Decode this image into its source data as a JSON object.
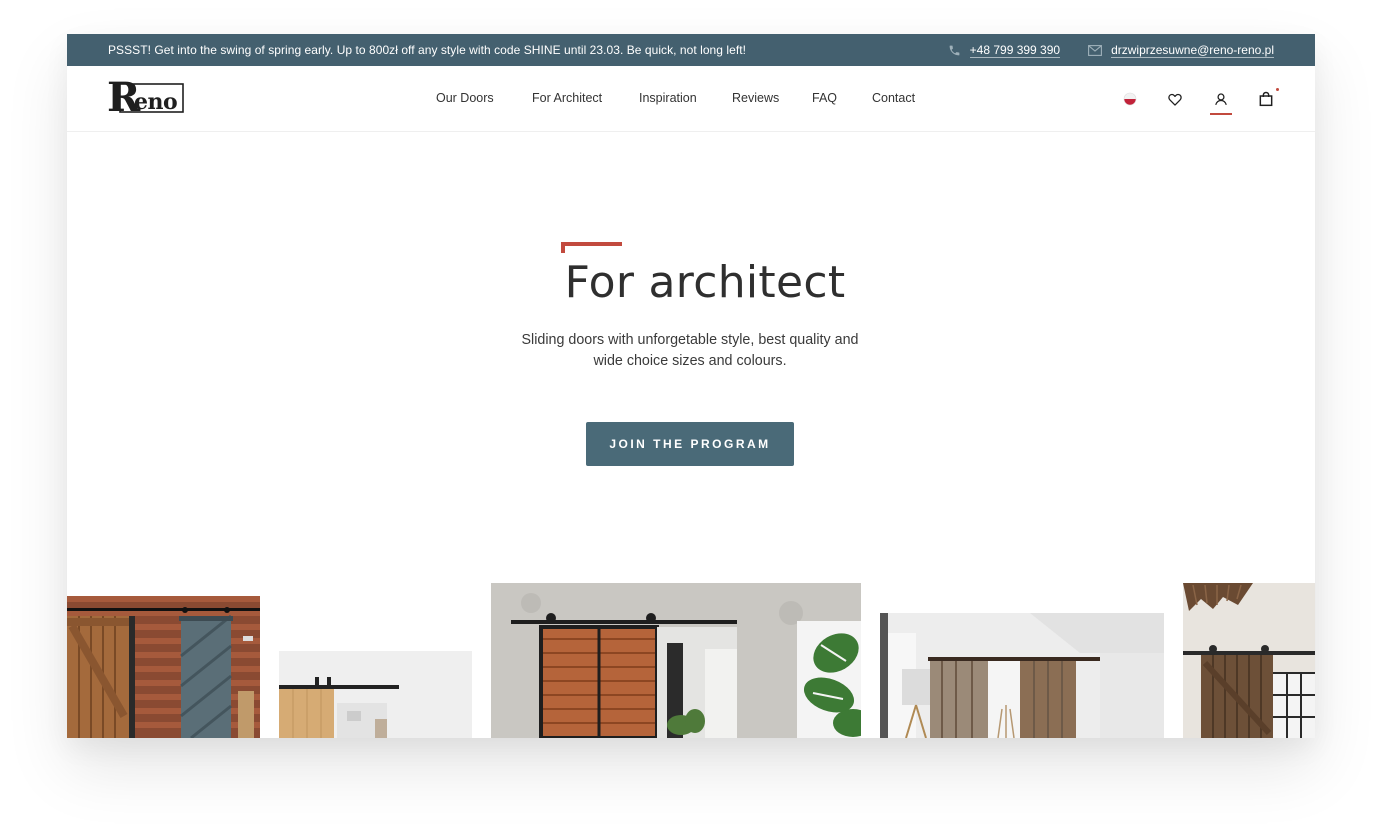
{
  "topbar": {
    "promo": "PSSST! Get into the swing of spring early. Up to 800zł off any style with code SHINE until 23.03. Be quick, not long left!",
    "phone": "+48 799 399 390",
    "email": "drzwiprzesuwne@reno-reno.pl",
    "phone_icon": "phone-icon",
    "email_icon": "mail-icon"
  },
  "header": {
    "logo_text": "Reno",
    "nav": [
      "Our Doors",
      "For Architect",
      "Inspiration",
      "Reviews",
      "FAQ",
      "Contact"
    ],
    "icons": [
      "language-flag-icon",
      "heart-icon",
      "user-icon",
      "bag-icon"
    ]
  },
  "hero": {
    "title": "For architect",
    "description": "Sliding doors with unforgetable style, best quality and wide choice sizes and colours.",
    "cta": "JOIN THE PROGRAM"
  },
  "colors": {
    "topbar_bg": "#44606f",
    "accent_red": "#c24a3e",
    "cta_bg": "#4a6a78"
  }
}
